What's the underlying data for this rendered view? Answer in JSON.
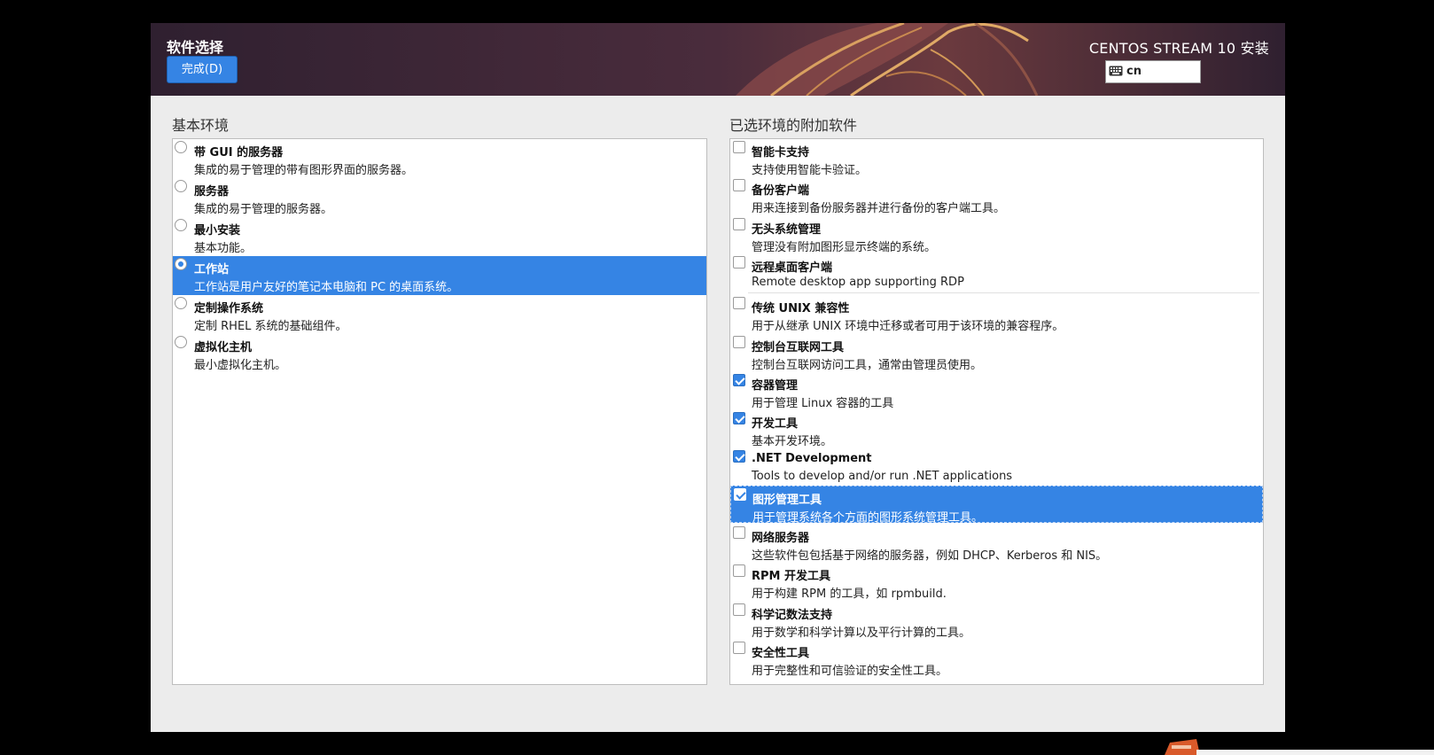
{
  "header": {
    "spoke_title": "软件选择",
    "done_label": "完成(D)",
    "product_title": "CENTOS STREAM 10 安装",
    "keyboard_layout": "cn",
    "keyboard_icon": "keyboard-icon"
  },
  "base_environment": {
    "label": "基本环境",
    "items": [
      {
        "title": "带 GUI 的服务器",
        "desc": "集成的易于管理的带有图形界面的服务器。",
        "selected": false
      },
      {
        "title": "服务器",
        "desc": "集成的易于管理的服务器。",
        "selected": false
      },
      {
        "title": "最小安装",
        "desc": "基本功能。",
        "selected": false
      },
      {
        "title": "工作站",
        "desc": "工作站是用户友好的笔记本电脑和 PC 的桌面系统。",
        "selected": true
      },
      {
        "title": "定制操作系统",
        "desc": "定制 RHEL 系统的基础组件。",
        "selected": false
      },
      {
        "title": "虚拟化主机",
        "desc": "最小虚拟化主机。",
        "selected": false
      }
    ]
  },
  "addons": {
    "label": "已选环境的附加软件",
    "items": [
      {
        "title": "智能卡支持",
        "desc": "支持使用智能卡验证。",
        "checked": false
      },
      {
        "title": "备份客户端",
        "desc": "用来连接到备份服务器并进行备份的客户端工具。",
        "checked": false
      },
      {
        "title": "无头系统管理",
        "desc": "管理没有附加图形显示终端的系统。",
        "checked": false
      },
      {
        "title": "远程桌面客户端",
        "desc": "Remote desktop app supporting RDP",
        "checked": false
      },
      {
        "title": "传统 UNIX 兼容性",
        "desc": "用于从继承 UNIX 环境中迁移或者可用于该环境的兼容程序。",
        "checked": false
      },
      {
        "title": "控制台互联网工具",
        "desc": "控制台互联网访问工具，通常由管理员使用。",
        "checked": false
      },
      {
        "title": "容器管理",
        "desc": "用于管理 Linux 容器的工具",
        "checked": true
      },
      {
        "title": "开发工具",
        "desc": "基本开发环境。",
        "checked": true
      },
      {
        "title": ".NET Development",
        "desc": "Tools to develop and/or run .NET applications",
        "checked": true
      },
      {
        "title": "图形管理工具",
        "desc": "用于管理系统各个方面的图形系统管理工具。",
        "checked": true,
        "highlighted": true
      },
      {
        "title": "网络服务器",
        "desc": "这些软件包包括基于网络的服务器，例如 DHCP、Kerberos 和 NIS。",
        "checked": false
      },
      {
        "title": "RPM 开发工具",
        "desc": "用于构建 RPM 的工具，如 rpmbuild.",
        "checked": false
      },
      {
        "title": "科学记数法支持",
        "desc": "用于数学和科学计算以及平行计算的工具。",
        "checked": false
      },
      {
        "title": "安全性工具",
        "desc": "用于完整性和可信验证的安全性工具。",
        "checked": false
      }
    ]
  },
  "colors": {
    "accent": "#3584e4",
    "header_bg": "#3e2a38",
    "window_bg": "#ececec",
    "screen_bg": "#000000"
  }
}
